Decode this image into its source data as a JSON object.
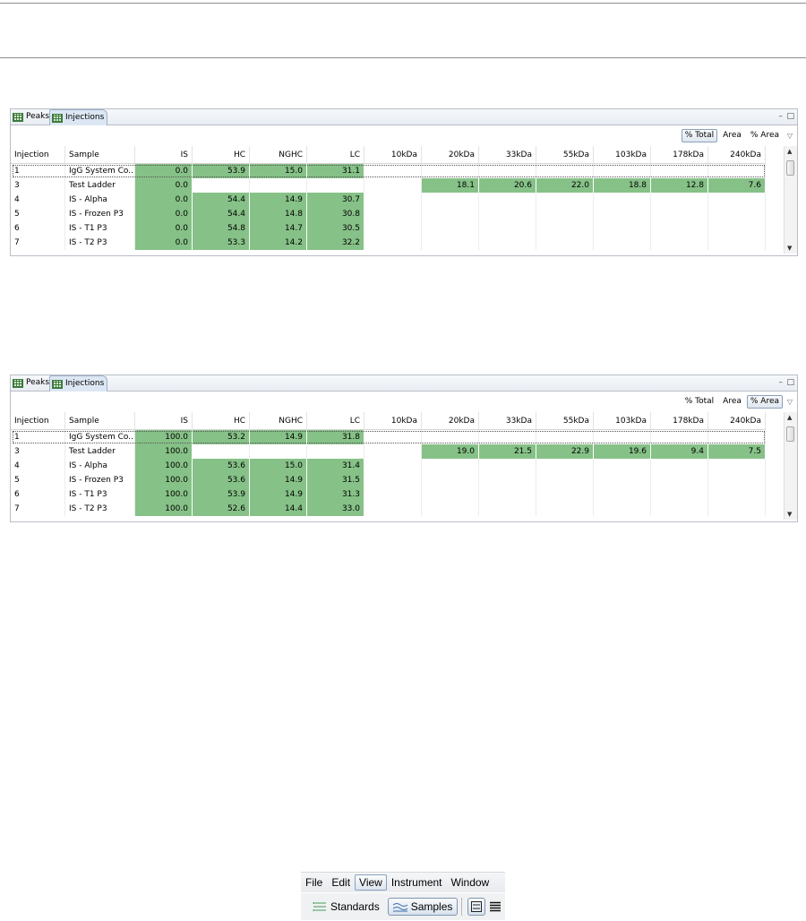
{
  "panels": [
    {
      "tabs": [
        "Peaks",
        "Injections"
      ],
      "active_tab": "Injections",
      "toolbar": [
        "% Total",
        "Area",
        "% Area"
      ],
      "selected_mode": "% Total",
      "columns": [
        "Injection",
        "Sample",
        "IS",
        "HC",
        "NGHC",
        "LC",
        "10kDa",
        "20kDa",
        "33kDa",
        "55kDa",
        "103kDa",
        "178kDa",
        "240kDa"
      ],
      "rows": [
        [
          "1",
          "IgG System Co...",
          "0.0",
          "53.9",
          "15.0",
          "31.1",
          "",
          "",
          "",
          "",
          "",
          "",
          ""
        ],
        [
          "3",
          "Test Ladder",
          "0.0",
          "",
          "",
          "",
          "",
          "18.1",
          "20.6",
          "22.0",
          "18.8",
          "12.8",
          "7.6"
        ],
        [
          "4",
          "IS - Alpha",
          "0.0",
          "54.4",
          "14.9",
          "30.7",
          "",
          "",
          "",
          "",
          "",
          "",
          ""
        ],
        [
          "5",
          "IS - Frozen P3",
          "0.0",
          "54.4",
          "14.8",
          "30.8",
          "",
          "",
          "",
          "",
          "",
          "",
          ""
        ],
        [
          "6",
          "IS - T1 P3",
          "0.0",
          "54.8",
          "14.7",
          "30.5",
          "",
          "",
          "",
          "",
          "",
          "",
          ""
        ],
        [
          "7",
          "IS - T2 P3",
          "0.0",
          "53.3",
          "14.2",
          "32.2",
          "",
          "",
          "",
          "",
          "",
          "",
          ""
        ]
      ]
    },
    {
      "tabs": [
        "Peaks",
        "Injections"
      ],
      "active_tab": "Injections",
      "toolbar": [
        "% Total",
        "Area",
        "% Area"
      ],
      "selected_mode": "% Area",
      "columns": [
        "Injection",
        "Sample",
        "IS",
        "HC",
        "NGHC",
        "LC",
        "10kDa",
        "20kDa",
        "33kDa",
        "55kDa",
        "103kDa",
        "178kDa",
        "240kDa"
      ],
      "rows": [
        [
          "1",
          "IgG System Co...",
          "100.0",
          "53.2",
          "14.9",
          "31.8",
          "",
          "",
          "",
          "",
          "",
          "",
          ""
        ],
        [
          "3",
          "Test Ladder",
          "100.0",
          "",
          "",
          "",
          "",
          "19.0",
          "21.5",
          "22.9",
          "19.6",
          "9.4",
          "7.5"
        ],
        [
          "4",
          "IS - Alpha",
          "100.0",
          "53.6",
          "15.0",
          "31.4",
          "",
          "",
          "",
          "",
          "",
          "",
          ""
        ],
        [
          "5",
          "IS - Frozen P3",
          "100.0",
          "53.6",
          "14.9",
          "31.5",
          "",
          "",
          "",
          "",
          "",
          "",
          ""
        ],
        [
          "6",
          "IS - T1 P3",
          "100.0",
          "53.9",
          "14.9",
          "31.3",
          "",
          "",
          "",
          "",
          "",
          "",
          ""
        ],
        [
          "7",
          "IS - T2 P3",
          "100.0",
          "52.6",
          "14.4",
          "33.0",
          "",
          "",
          "",
          "",
          "",
          "",
          ""
        ]
      ]
    }
  ],
  "menubar": {
    "items": [
      "File",
      "Edit",
      "View",
      "Instrument",
      "Window"
    ],
    "selected": "View"
  },
  "modebar": {
    "standards": "Standards",
    "samples": "Samples",
    "selected": "Samples"
  },
  "colors": {
    "highlight_cell": "#86c187"
  }
}
